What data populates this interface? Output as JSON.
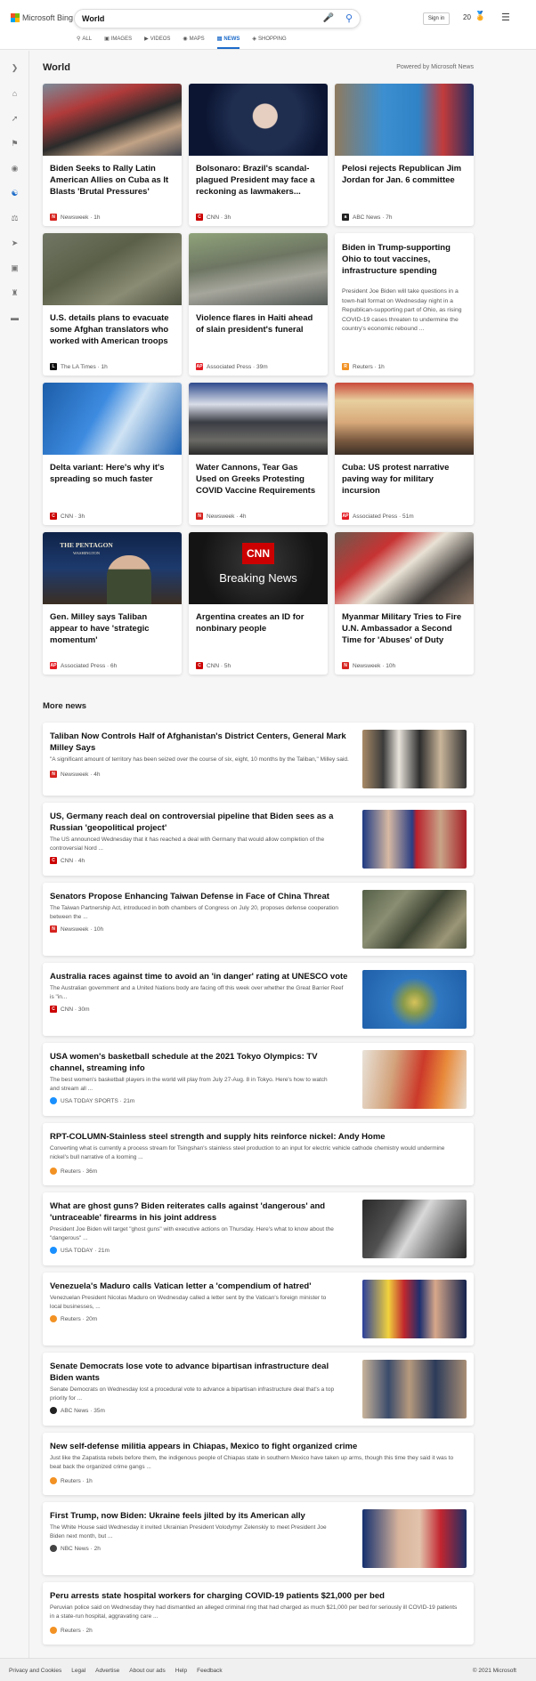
{
  "header": {
    "brand": "Microsoft Bing",
    "search_value": "World",
    "sign_in": "Sign in",
    "points": "20"
  },
  "scopes": [
    {
      "label": "ALL",
      "icon": "search-icon"
    },
    {
      "label": "IMAGES",
      "icon": "image-icon"
    },
    {
      "label": "VIDEOS",
      "icon": "video-icon"
    },
    {
      "label": "MAPS",
      "icon": "map-pin-icon"
    },
    {
      "label": "NEWS",
      "icon": "news-icon",
      "active": true
    },
    {
      "label": "SHOPPING",
      "icon": "tag-icon"
    }
  ],
  "section": {
    "title": "World",
    "powered_by": "Powered by Microsoft News",
    "more_title": "More news"
  },
  "cards": [
    {
      "title": "Biden Seeks to Rally Latin American Allies on Cuba as It Blasts 'Brutal Pressures'",
      "source": "Newsweek",
      "age": "1h",
      "logo_color": "#d6231f"
    },
    {
      "title": "Bolsonaro: Brazil's scandal-plagued President may face a reckoning as lawmakers...",
      "source": "CNN",
      "age": "3h",
      "logo_color": "#cc0000"
    },
    {
      "title": "Pelosi rejects Republican Jim Jordan for Jan. 6 committee",
      "source": "ABC News",
      "age": "7h",
      "logo_color": "#222222"
    },
    {
      "title": "U.S. details plans to evacuate some Afghan translators who worked with American troops",
      "source": "The LA Times",
      "age": "1h",
      "logo_color": "#111111"
    },
    {
      "title": "Violence flares in Haiti ahead of slain president's funeral",
      "source": "Associated Press",
      "age": "39m",
      "logo_color": "#e41b23"
    },
    {
      "title": "Biden in Trump-supporting Ohio to tout vaccines, infrastructure spending",
      "snippet": "President Joe Biden will take questions in a town-hall format on Wednesday night in a Republican-supporting part of Ohio, as rising COVID-19 cases threaten to undermine the country's economic rebound ...",
      "source": "Reuters",
      "age": "1h",
      "logo_color": "#f29224"
    },
    {
      "title": "Delta variant: Here's why it's spreading so much faster",
      "source": "CNN",
      "age": "3h",
      "logo_color": "#cc0000"
    },
    {
      "title": "Water Cannons, Tear Gas Used on Greeks Protesting COVID Vaccine Requirements",
      "source": "Newsweek",
      "age": "4h",
      "logo_color": "#d6231f"
    },
    {
      "title": "Cuba: US protest narrative paving way for military incursion",
      "source": "Associated Press",
      "age": "51m",
      "logo_color": "#e41b23"
    },
    {
      "title": "Gen. Milley says Taliban appear to have 'strategic momentum'",
      "source": "Associated Press",
      "age": "6h",
      "logo_color": "#e41b23"
    },
    {
      "title": "Argentina creates an ID for nonbinary people",
      "source": "CNN",
      "age": "5h",
      "logo_color": "#cc0000"
    },
    {
      "title": "Myanmar Military Tries to Fire U.N. Ambassador a Second Time for 'Abuses' of Duty",
      "source": "Newsweek",
      "age": "10h",
      "logo_color": "#d6231f"
    }
  ],
  "breaking": {
    "cnn": "CNN",
    "text": "Breaking News"
  },
  "pentagon": {
    "line1": "THE PENTAGON",
    "line2": "WASHINGTON"
  },
  "more_news": [
    {
      "title": "Taliban Now Controls Half of Afghanistan's District Centers, General Mark Milley Says",
      "snippet": "\"A significant amount of territory has been seized over the course of six, eight, 10 months by the Taliban,\" Milley said.",
      "source": "Newsweek",
      "age": "4h",
      "logo_color": "#d6231f"
    },
    {
      "title": "US, Germany reach deal on controversial pipeline that Biden sees as a Russian 'geopolitical project'",
      "snippet": "The US announced Wednesday that it has reached a deal with Germany that would allow completion of the controversial Nord ...",
      "source": "CNN",
      "age": "4h",
      "logo_color": "#cc0000"
    },
    {
      "title": "Senators Propose Enhancing Taiwan Defense in Face of China Threat",
      "snippet": "The Taiwan Partnership Act, introduced in both chambers of Congress on July 20, proposes defense cooperation between the ...",
      "source": "Newsweek",
      "age": "10h",
      "logo_color": "#d6231f"
    },
    {
      "title": "Australia races against time to avoid an 'in danger' rating at UNESCO vote",
      "snippet": "The Australian government and a United Nations body are facing off this week over whether the Great Barrier Reef is \"in...",
      "source": "CNN",
      "age": "30m",
      "logo_color": "#cc0000"
    },
    {
      "title": "USA women's basketball schedule at the 2021 Tokyo Olympics: TV channel, streaming info",
      "snippet": "The best women's basketball players in the world will play from July 27-Aug. 8 in Tokyo. Here's how to watch and stream all ...",
      "source": "USA TODAY SPORTS",
      "age": "21m",
      "logo_color": "#1a90ff"
    },
    {
      "title": "RPT-COLUMN-Stainless steel strength and supply hits reinforce nickel: Andy Home",
      "snippet": "Converting what is currently a process stream for Tsingshan's stainless steel production to an input for electric vehicle cathode chemistry would undermine nickel's bull narrative of a looming ...",
      "source": "Reuters",
      "age": "36m",
      "logo_color": "#f29224"
    },
    {
      "title": "What are ghost guns? Biden reiterates calls against 'dangerous' and 'untraceable' firearms in his joint address",
      "snippet": "President Joe Biden will target \"ghost guns\" with executive actions on Thursday. Here's what to know about the \"dangerous\" ...",
      "source": "USA TODAY",
      "age": "21m",
      "logo_color": "#1a90ff"
    },
    {
      "title": "Venezuela's Maduro calls Vatican letter a 'compendium of hatred'",
      "snippet": "Venezuelan President Nicolas Maduro on Wednesday called a letter sent by the Vatican's foreign minister to local businesses, ...",
      "source": "Reuters",
      "age": "20m",
      "logo_color": "#f29224"
    },
    {
      "title": "Senate Democrats lose vote to advance bipartisan infrastructure deal Biden wants",
      "snippet": "Senate Democrats on Wednesday lost a procedural vote to advance a bipartisan infrastructure deal that's a top priority for ...",
      "source": "ABC News",
      "age": "35m",
      "logo_color": "#222222"
    },
    {
      "title": "New self-defense militia appears in Chiapas, Mexico to fight organized crime",
      "snippet": "Just like the Zapatista rebels before them, the indigenous people of Chiapas state in southern Mexico have taken up arms, though this time they said it was to beat back the organized crime gangs ...",
      "source": "Reuters",
      "age": "1h",
      "logo_color": "#f29224"
    },
    {
      "title": "First Trump, now Biden: Ukraine feels jilted by its American ally",
      "snippet": "The White House said Wednesday it invited Ukrainian President Volodymyr Zelenskiy to meet President Joe Biden next month, but ...",
      "source": "NBC News",
      "age": "2h",
      "logo_color": "#444444"
    },
    {
      "title": "Peru arrests state hospital workers for charging COVID-19 patients $21,000 per bed",
      "snippet": "Peruvian police said on Wednesday they had dismantled an alleged criminal ring that had charged as much $21,000 per bed for seriously ill COVID-19 patients in a state-run hospital, aggravating care ...",
      "source": "Reuters",
      "age": "2h",
      "logo_color": "#f29224"
    }
  ],
  "footer": {
    "links": [
      "Privacy and Cookies",
      "Legal",
      "Advertise",
      "About our ads",
      "Help",
      "Feedback"
    ],
    "copyright": "© 2021 Microsoft"
  }
}
